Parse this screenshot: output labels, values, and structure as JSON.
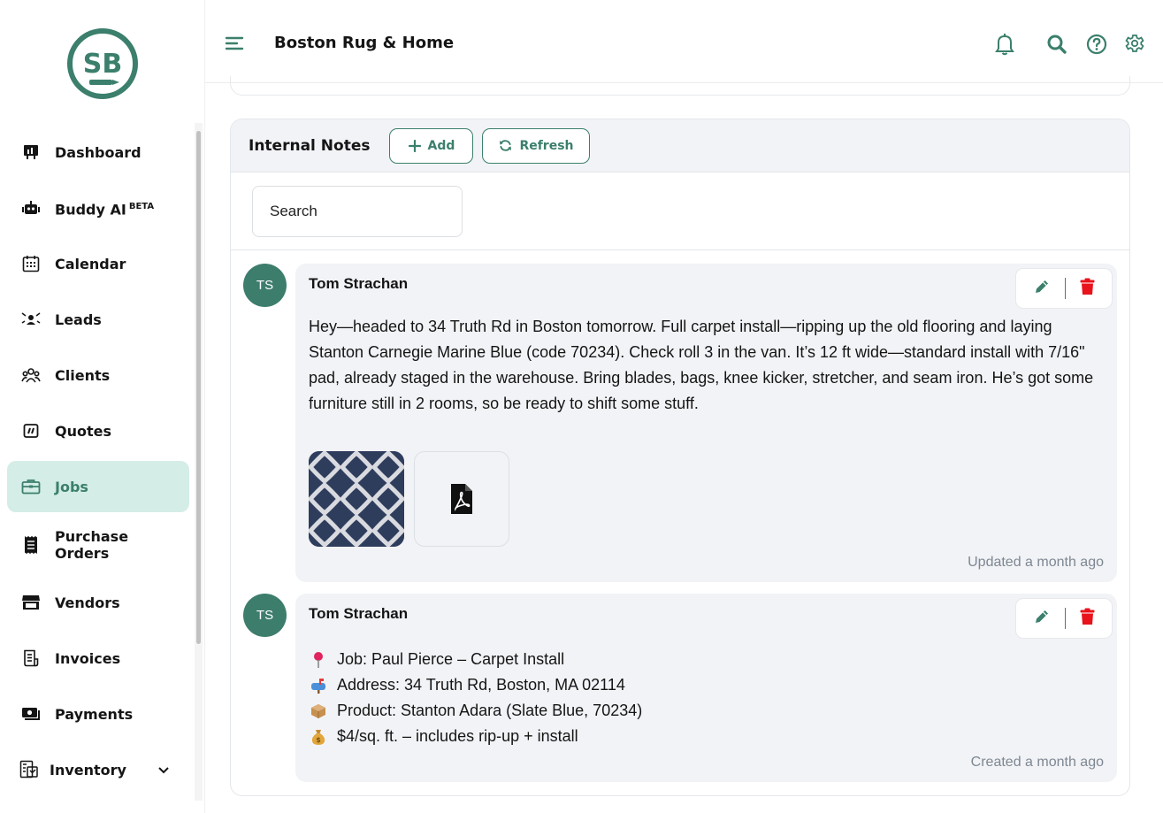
{
  "brand": {
    "logo_text": "SB",
    "name": "Boston Rug & Home"
  },
  "colors": {
    "accent": "#3b7f6c",
    "active_bg": "#d4ede6",
    "delete": "#e8131b",
    "bubble_bg": "#f2f3f6"
  },
  "sidebar": {
    "items": [
      {
        "label": "Dashboard",
        "icon": "dashboard-icon"
      },
      {
        "label": "Buddy AI",
        "badge": "BETA",
        "icon": "robot-icon"
      },
      {
        "label": "Calendar",
        "icon": "calendar-icon"
      },
      {
        "label": "Leads",
        "icon": "leads-icon"
      },
      {
        "label": "Clients",
        "icon": "clients-icon"
      },
      {
        "label": "Quotes",
        "icon": "quotes-icon"
      },
      {
        "label": "Jobs",
        "icon": "briefcase-icon",
        "active": true
      },
      {
        "label": "Purchase Orders",
        "icon": "receipt-icon"
      },
      {
        "label": "Vendors",
        "icon": "store-icon"
      },
      {
        "label": "Invoices",
        "icon": "invoice-icon"
      },
      {
        "label": "Payments",
        "icon": "payments-icon"
      },
      {
        "label": "Inventory",
        "icon": "inventory-icon",
        "expandable": true
      }
    ]
  },
  "header": {
    "icons": [
      "menu-icon",
      "bell-icon",
      "search-icon",
      "help-icon",
      "gear-icon"
    ]
  },
  "notes": {
    "title": "Internal Notes",
    "add_label": "Add",
    "refresh_label": "Refresh",
    "search_placeholder": "Search",
    "items": [
      {
        "initials": "TS",
        "author": "Tom Strachan",
        "body": "Hey—headed to 34 Truth Rd in Boston tomorrow. Full carpet install—ripping up the old flooring and laying Stanton Carnegie Marine Blue (code 70234).  Check roll 3 in the van. It’s 12 ft wide—standard install with 7/16\" pad, already staged in the warehouse. Bring blades, bags, knee kicker, stretcher, and seam iron. He’s got some furniture still in 2 rooms, so be ready to shift some stuff.",
        "attachments": [
          "carpet-sample-image",
          "pdf-file-icon"
        ],
        "timestamp": "Updated a month ago"
      },
      {
        "initials": "TS",
        "author": "Tom Strachan",
        "lines": [
          {
            "icon": "pin-icon",
            "text": "Job: Paul Pierce – Carpet Install"
          },
          {
            "icon": "mailbox-icon",
            "text": "Address: 34 Truth Rd, Boston, MA 02114"
          },
          {
            "icon": "package-icon",
            "text": "Product: Stanton Adara (Slate Blue, 70234)"
          },
          {
            "icon": "money-bag-icon",
            "text": "$4/sq. ft. – includes rip-up + install"
          }
        ],
        "timestamp": "Created a month ago"
      }
    ]
  }
}
